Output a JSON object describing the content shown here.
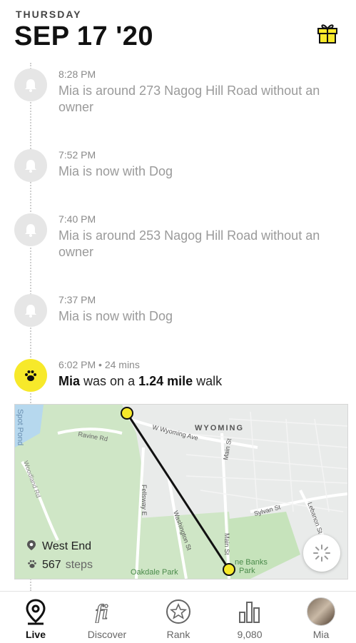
{
  "header": {
    "weekday": "THURSDAY",
    "date": "SEP 17 '20"
  },
  "events": [
    {
      "time": "8:28 PM",
      "text": "Mia is around 273 Nagog Hill Road without an owner",
      "icon": "bell-icon"
    },
    {
      "time": "7:52 PM",
      "text": "Mia is now with Dog",
      "icon": "bell-icon"
    },
    {
      "time": "7:40 PM",
      "text": "Mia is around 253 Nagog Hill Road without an owner",
      "icon": "bell-icon"
    },
    {
      "time": "7:37 PM",
      "text": "Mia is now with Dog",
      "icon": "bell-icon"
    }
  ],
  "walk": {
    "time": "6:02 PM • 24 mins",
    "name": "Mia",
    "pre": "was on a",
    "distance": "1.24 mile",
    "post": "walk",
    "icon": "paw-icon"
  },
  "map": {
    "labels": {
      "spot_pond": "Spot Pond",
      "ravine": "Ravine Rd",
      "woodland": "Woodland Rd",
      "wyoming_ave": "W Wyoming Ave",
      "wyoming": "WYOMING",
      "main_st_1": "Main St",
      "fellsway": "Fellsway E",
      "washington": "Washington St",
      "sylvan": "Sylvan St",
      "lebanon": "Lebanon St",
      "main_st_2": "Main St",
      "oakdale": "Oakdale Park",
      "banks": "ne Banks\nPark"
    },
    "location": "West End",
    "steps_value": "567",
    "steps_label": "steps"
  },
  "tabs": [
    {
      "label": "Live",
      "icon": "location-pin-icon",
      "active": true
    },
    {
      "label": "Discover",
      "icon": "fi-logo-icon",
      "active": false
    },
    {
      "label": "Rank",
      "icon": "star-icon",
      "active": false
    },
    {
      "label": "9,080",
      "icon": "bar-chart-icon",
      "active": false
    },
    {
      "label": "Mia",
      "icon": "avatar",
      "active": false
    }
  ],
  "colors": {
    "accent": "#f7e92a",
    "inactive_icon": "#e6e6e6",
    "route": "#111111"
  }
}
